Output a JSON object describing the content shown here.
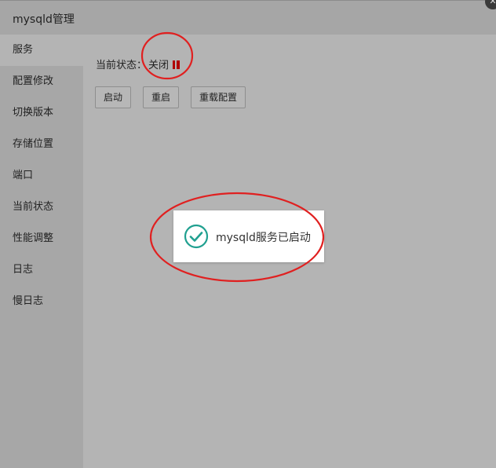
{
  "window": {
    "title": "mysqld管理",
    "close_icon": "close-icon"
  },
  "sidebar": {
    "items": [
      {
        "label": "服务",
        "active": true
      },
      {
        "label": "配置修改"
      },
      {
        "label": "切换版本"
      },
      {
        "label": "存储位置"
      },
      {
        "label": "端口"
      },
      {
        "label": "当前状态"
      },
      {
        "label": "性能调整"
      },
      {
        "label": "日志"
      },
      {
        "label": "慢日志"
      }
    ]
  },
  "main": {
    "status_label": "当前状态：",
    "status_value": "关闭",
    "status_icon": "pause-icon",
    "buttons": {
      "start": "启动",
      "restart": "重启",
      "reload": "重载配置"
    }
  },
  "toast": {
    "message": "mysqld服务已启动",
    "icon": "check-circle-icon"
  },
  "colors": {
    "annotation": "#e02020",
    "check": "#20a090",
    "status_icon": "#b00000"
  }
}
